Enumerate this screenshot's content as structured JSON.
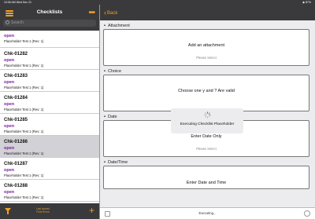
{
  "statusbar": {
    "time": "10:06 AM  Wed Dec 21",
    "right": "◉ 87%"
  },
  "left": {
    "title": "Checklists",
    "search_placeholder": "Search",
    "items": [
      {
        "id": "",
        "status": "open",
        "sub": "Placeholder Test 1 (Rev: 1)"
      },
      {
        "id": "Chk-01282",
        "status": "open",
        "sub": "Placeholder Test 1 (Rev: 1)"
      },
      {
        "id": "Chk-01283",
        "status": "open",
        "sub": "Placeholder Test 1 (Rev: 1)"
      },
      {
        "id": "Chk-01284",
        "status": "open",
        "sub": "Placeholder Test 1 (Rev: 1)"
      },
      {
        "id": "Chk-01285",
        "status": "open",
        "sub": "Placeholder Test 1 (Rev: 1)"
      },
      {
        "id": "Chk-01286",
        "status": "open",
        "sub": "Placeholder Test 1 (Rev: 1)"
      },
      {
        "id": "Chk-01287",
        "status": "open",
        "sub": "Placeholder Test 1 (Rev: 1)"
      },
      {
        "id": "Chk-01288",
        "status": "open",
        "sub": "Placeholder Test 1 (Rev: 1)"
      }
    ],
    "selected_index": 5,
    "footer_text_1": "Last synced",
    "footer_text_2": "Pulls Errors"
  },
  "right": {
    "back_label": "Back",
    "sections": [
      {
        "title": "Attachment",
        "main": "Add an attachment",
        "hint": "Please Select"
      },
      {
        "title": "Choice",
        "main": "Choose one y and ? Are valid",
        "hint": ""
      },
      {
        "title": "Date",
        "main": "Enter Date Only",
        "hint": "Please Select"
      },
      {
        "title": "Date/Time",
        "main": "Enter Date and Time",
        "hint": ""
      }
    ],
    "overlay_message": "Executing Checklist Placeholder",
    "footer_status": "Executing..."
  },
  "colors": {
    "accent": "#f0a020",
    "status_open": "#7b1fa2",
    "header_bg": "#3a3a3c"
  }
}
